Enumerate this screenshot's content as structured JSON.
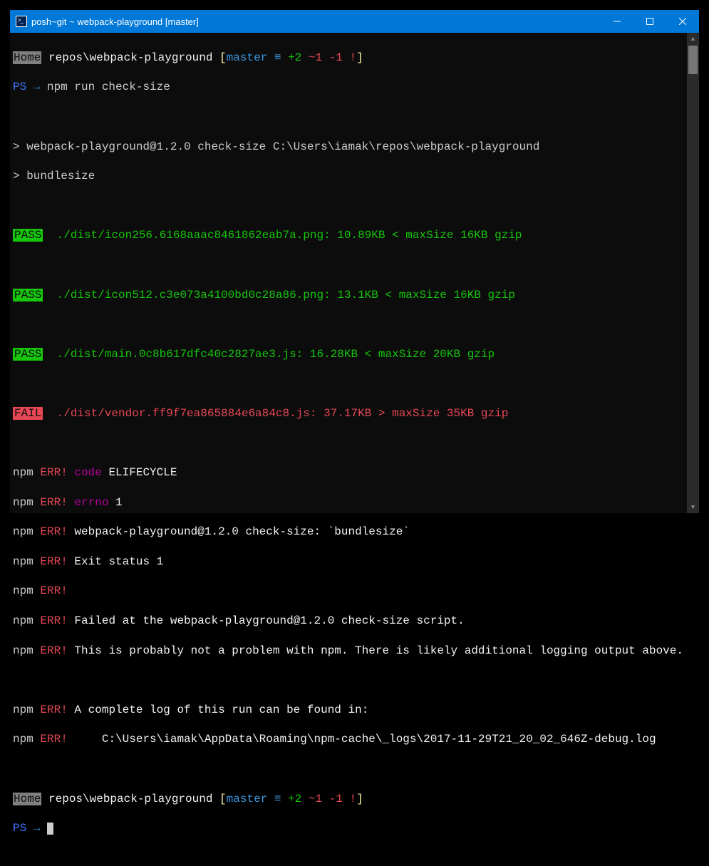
{
  "window": {
    "title": "posh~git ~ webpack-playground [master]"
  },
  "prompt1": {
    "home": "Home",
    "path": " repos\\webpack-playground ",
    "bracket_open": "[",
    "branch": "master",
    "equiv": " ≡",
    "ahead": " +2",
    "behind": " ~1",
    "rm": " -1",
    "ex": " !",
    "bracket_close": "]"
  },
  "ps_line": {
    "ps": "PS",
    "arrow": " → ",
    "cmd": "npm run check-size"
  },
  "npm_header1": "> webpack-playground@1.2.0 check-size C:\\Users\\iamak\\repos\\webpack-playground",
  "npm_header2": "> bundlesize",
  "results": [
    {
      "status": "PASS",
      "text": "./dist/icon256.6168aaac8461862eab7a.png: 10.89KB < maxSize 16KB gzip"
    },
    {
      "status": "PASS",
      "text": "./dist/icon512.c3e073a4100bd0c28a86.png: 13.1KB < maxSize 16KB gzip"
    },
    {
      "status": "PASS",
      "text": "./dist/main.0c8b617dfc40c2827ae3.js: 16.28KB < maxSize 20KB gzip"
    },
    {
      "status": "FAIL",
      "text": "./dist/vendor.ff9f7ea865884e6a84c8.js: 37.17KB > maxSize 35KB gzip"
    }
  ],
  "err": {
    "npm": "npm",
    "ERR": " ERR!",
    "code_lbl": " code",
    "code_val": " ELIFECYCLE",
    "errno_lbl": " errno",
    "errno_val": " 1",
    "l3a": " webpack-playground@1.2.0 check-size: ",
    "l3b": "`bundlesize`",
    "l4": " Exit status 1",
    "l6": " Failed at the webpack-playground@1.2.0 check-size script.",
    "l7": " This is probably not a problem with npm. There is likely additional logging output above.",
    "l9": " A complete log of this run can be found in:",
    "l10": "     C:\\Users\\iamak\\AppData\\Roaming\\npm-cache\\_logs\\2017-11-29T21_20_02_646Z-debug.log"
  },
  "prompt2": {
    "home": "Home",
    "path": " repos\\webpack-playground ",
    "bracket_open": "[",
    "branch": "master",
    "equiv": " ≡",
    "ahead": " +2",
    "behind": " ~1",
    "rm": " -1",
    "ex": " !",
    "bracket_close": "]"
  },
  "ps_line2": {
    "ps": "PS",
    "arrow": " → "
  }
}
